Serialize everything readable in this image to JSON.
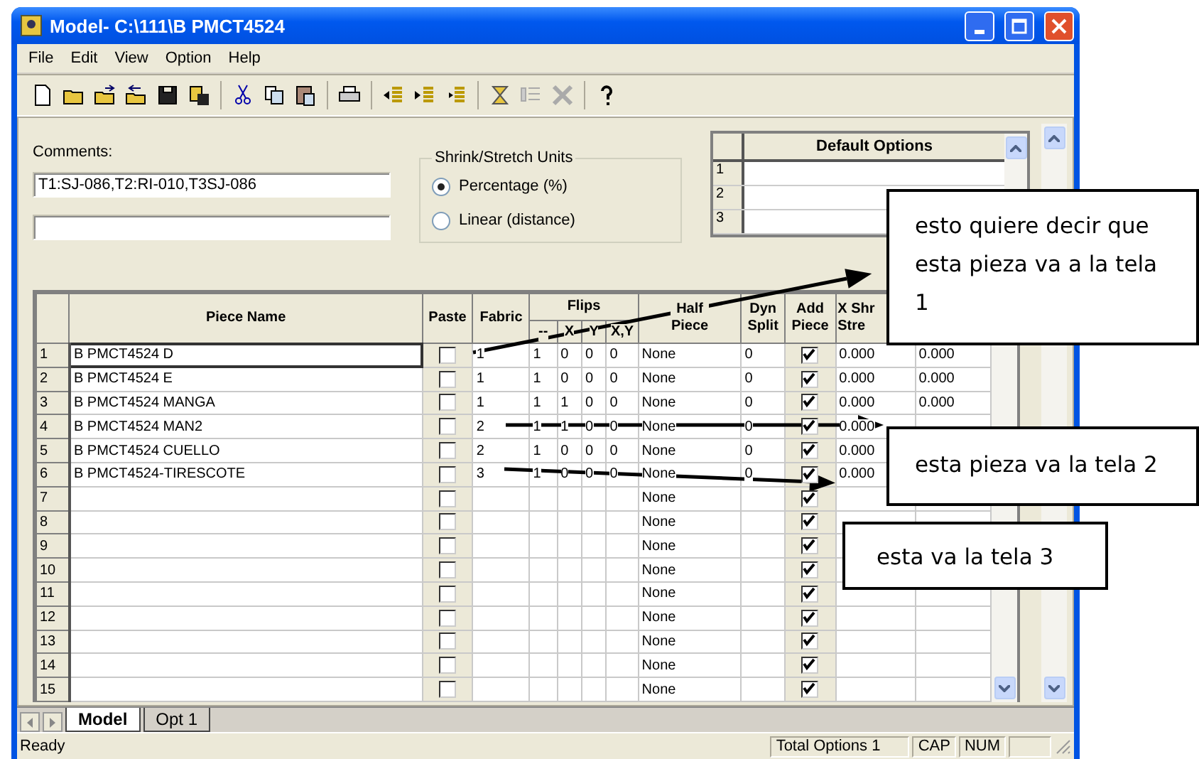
{
  "window": {
    "title": "Model- C:\\111\\B PMCT4524"
  },
  "menu": [
    "File",
    "Edit",
    "View",
    "Option",
    "Help"
  ],
  "comments": {
    "label": "Comments:",
    "value": "T1:SJ-086,T2:RI-010,T3SJ-086"
  },
  "shrink_units": {
    "title": "Shrink/Stretch Units",
    "options": [
      {
        "label": "Percentage (%)",
        "selected": true
      },
      {
        "label": "Linear (distance)",
        "selected": false
      }
    ]
  },
  "default_options": {
    "header": "Default Options",
    "rows": [
      "1",
      "2",
      "3"
    ]
  },
  "grid": {
    "columns": {
      "name": "Piece Name",
      "paste": "Paste",
      "fabric": "Fabric",
      "flips": "Flips",
      "flip_subs": [
        "--",
        "X",
        "Y",
        "X,Y"
      ],
      "half": [
        "Half",
        "Piece"
      ],
      "dyn": [
        "Dyn",
        "Split"
      ],
      "add": [
        "Add",
        "Piece"
      ],
      "shrink": [
        "X Shr",
        "Stre"
      ]
    },
    "rows": [
      {
        "num": "1",
        "name": "B PMCT4524 D",
        "paste": false,
        "fabric": "1",
        "flips": [
          "1",
          "0",
          "0",
          "0"
        ],
        "half": "None",
        "dyn": "0",
        "add": true,
        "shrink": "0.000",
        "column_11": "0.000"
      },
      {
        "num": "2",
        "name": "B PMCT4524 E",
        "paste": false,
        "fabric": "1",
        "flips": [
          "1",
          "0",
          "0",
          "0"
        ],
        "half": "None",
        "dyn": "0",
        "add": true,
        "shrink": "0.000",
        "column_11": "0.000"
      },
      {
        "num": "3",
        "name": "B PMCT4524 MANGA",
        "paste": false,
        "fabric": "1",
        "flips": [
          "1",
          "1",
          "0",
          "0"
        ],
        "half": "None",
        "dyn": "0",
        "add": true,
        "shrink": "0.000",
        "column_11": "0.000"
      },
      {
        "num": "4",
        "name": "B PMCT4524 MAN2",
        "paste": false,
        "fabric": "2",
        "flips": [
          "1",
          "1",
          "0",
          "0"
        ],
        "half": "None",
        "dyn": "0",
        "add": true,
        "shrink": "0.000"
      },
      {
        "num": "5",
        "name": "B PMCT4524 CUELLO",
        "paste": false,
        "fabric": "2",
        "flips": [
          "1",
          "0",
          "0",
          "0"
        ],
        "half": "None",
        "dyn": "0",
        "add": true,
        "shrink": "0.000"
      },
      {
        "num": "6",
        "name": "B PMCT4524-TIRESCOTE",
        "paste": false,
        "fabric": "3",
        "flips": [
          "1",
          "0",
          "0",
          "0"
        ],
        "half": "None",
        "dyn": "0",
        "add": true,
        "shrink": "0.000"
      },
      {
        "num": "7",
        "paste": false,
        "half": "None",
        "add": true
      },
      {
        "num": "8",
        "paste": false,
        "half": "None",
        "add": true
      },
      {
        "num": "9",
        "paste": false,
        "half": "None",
        "add": true
      },
      {
        "num": "10",
        "paste": false,
        "half": "None",
        "add": true
      },
      {
        "num": "11",
        "paste": false,
        "half": "None",
        "add": true
      },
      {
        "num": "12",
        "paste": false,
        "half": "None",
        "add": true
      },
      {
        "num": "13",
        "paste": false,
        "half": "None",
        "add": true
      },
      {
        "num": "14",
        "paste": false,
        "half": "None",
        "add": true
      },
      {
        "num": "15",
        "paste": false,
        "half": "None",
        "add": true
      }
    ]
  },
  "sheet_tabs": [
    {
      "label": "Model",
      "selected": true
    },
    {
      "label": "Opt 1",
      "selected": false
    }
  ],
  "status_bar": {
    "message": "Ready",
    "options": "Total Options 1",
    "caps": "CAP",
    "num": "NUM"
  },
  "annotations": [
    {
      "text": "esto quiere decir que esta pieza va a la tela 1"
    },
    {
      "text": "esta pieza va la tela 2"
    },
    {
      "text": "esta va la tela 3"
    }
  ]
}
